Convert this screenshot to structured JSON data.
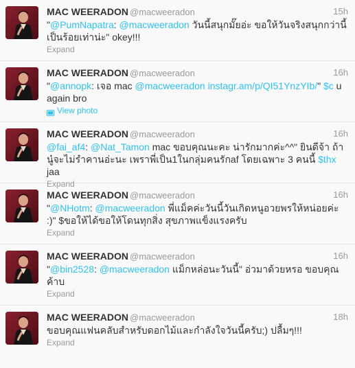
{
  "tweets": [
    {
      "name": "MAC WEERADON",
      "handle": "@macweeradon",
      "time": "15h",
      "parts": [
        {
          "t": "text",
          "v": "\""
        },
        {
          "t": "mention",
          "v": "@PumNapatra"
        },
        {
          "t": "text",
          "v": ": "
        },
        {
          "t": "mention",
          "v": "@macweeradon"
        },
        {
          "t": "text",
          "v": " วันนี้สนุกมั๊ยอ่ะ ขอให้วันจริงสนุกกว่านี้เป็นร้อยเท่าน่ะ\" okey!!!"
        }
      ],
      "action": "Expand"
    },
    {
      "name": "MAC WEERADON",
      "handle": "@macweeradon",
      "time": "16h",
      "parts": [
        {
          "t": "text",
          "v": "\""
        },
        {
          "t": "mention",
          "v": "@annopk"
        },
        {
          "t": "text",
          "v": ": เจอ mac "
        },
        {
          "t": "mention",
          "v": "@macweeradon"
        },
        {
          "t": "text",
          "v": " "
        },
        {
          "t": "link",
          "v": "instagr.am/p/QI51YnzYIb/"
        },
        {
          "t": "text",
          "v": "\" "
        },
        {
          "t": "cashtag",
          "v": "$c"
        },
        {
          "t": "text",
          "v": " u again bro"
        }
      ],
      "action": "View photo",
      "action_type": "photo"
    },
    {
      "name": "MAC WEERADON",
      "handle": "@macweeradon",
      "time": "16h",
      "parts": [
        {
          "t": "mention",
          "v": "@fai_af4"
        },
        {
          "t": "text",
          "v": ": "
        },
        {
          "t": "mention",
          "v": "@Nat_Tamon"
        },
        {
          "t": "text",
          "v": " mac ขอบคุณนะคะ น่ารักมากค่ะ^^\" ยินดีจ้า ถ้านู๋จะไม่รำคานอ่ะนะ เพราพี่เป็น1ในกลุ่มคนรักaf โดยเฉพาะ 3 คนนี้ "
        },
        {
          "t": "cashtag",
          "v": "$thx"
        },
        {
          "t": "text",
          "v": " jaa"
        }
      ],
      "action": "Expand"
    },
    {
      "name": "MAC WEERADON",
      "handle": "@macweeradon",
      "time": "16h",
      "parts": [
        {
          "t": "text",
          "v": "\""
        },
        {
          "t": "mention",
          "v": "@NHotm"
        },
        {
          "t": "text",
          "v": ": "
        },
        {
          "t": "mention",
          "v": "@macweeradon"
        },
        {
          "t": "text",
          "v": " พี่แม็คค่ะวันนี้วันเกิดหนูอวยพรให้หน่อยค่ะ :)\" $ขอให้ได้ขอให้โดนทุกสิ่ง สุขภาพแข็งแรงครับ"
        }
      ],
      "action": "Expand"
    },
    {
      "name": "MAC WEERADON",
      "handle": "@macweeradon",
      "time": "16h",
      "parts": [
        {
          "t": "text",
          "v": "\""
        },
        {
          "t": "mention",
          "v": "@bin2528"
        },
        {
          "t": "text",
          "v": ": "
        },
        {
          "t": "mention",
          "v": "@macweeradon"
        },
        {
          "t": "text",
          "v": " แม็กหล่อนะวันนี้\" อ่วมาด้วยหรอ ขอบคุณค้าบ"
        }
      ],
      "action": "Expand"
    },
    {
      "name": "MAC WEERADON",
      "handle": "@macweeradon",
      "time": "18h",
      "parts": [
        {
          "t": "text",
          "v": "ขอบคุณแฟนคลับสำหรับดอกไม้และกำลังใจวันนี้ครับ;) ปลื้มๆ!!!"
        }
      ],
      "action": "Expand"
    }
  ]
}
